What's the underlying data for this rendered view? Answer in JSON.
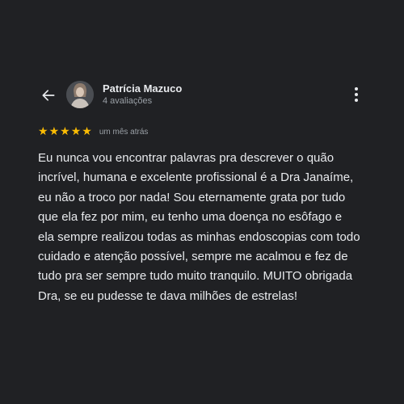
{
  "reviewer": {
    "name": "Patrícia Mazuco",
    "review_count": "4 avaliações"
  },
  "review": {
    "rating": 5,
    "max_rating": 5,
    "time": "um mês atrás",
    "text": "Eu nunca vou encontrar palavras pra descrever o quão incrível, humana e excelente profissional é a Dra Janaíme, eu não a troco por nada! Sou eternamente grata por tudo que ela fez por mim, eu tenho uma doença no esôfago e ela sempre realizou todas as minhas endoscopias com todo cuidado e atenção possível, sempre me acalmou e fez de tudo pra ser sempre tudo muito tranquilo. MUITO obrigada Dra, se eu pudesse te dava milhões de estrelas!"
  },
  "icons": {
    "back": "arrow-left-icon",
    "menu": "more-vertical-icon",
    "star": "star-icon"
  },
  "colors": {
    "background": "#202124",
    "star": "#fbbc04",
    "text": "#e8eaed",
    "secondary_text": "#9aa0a6"
  }
}
